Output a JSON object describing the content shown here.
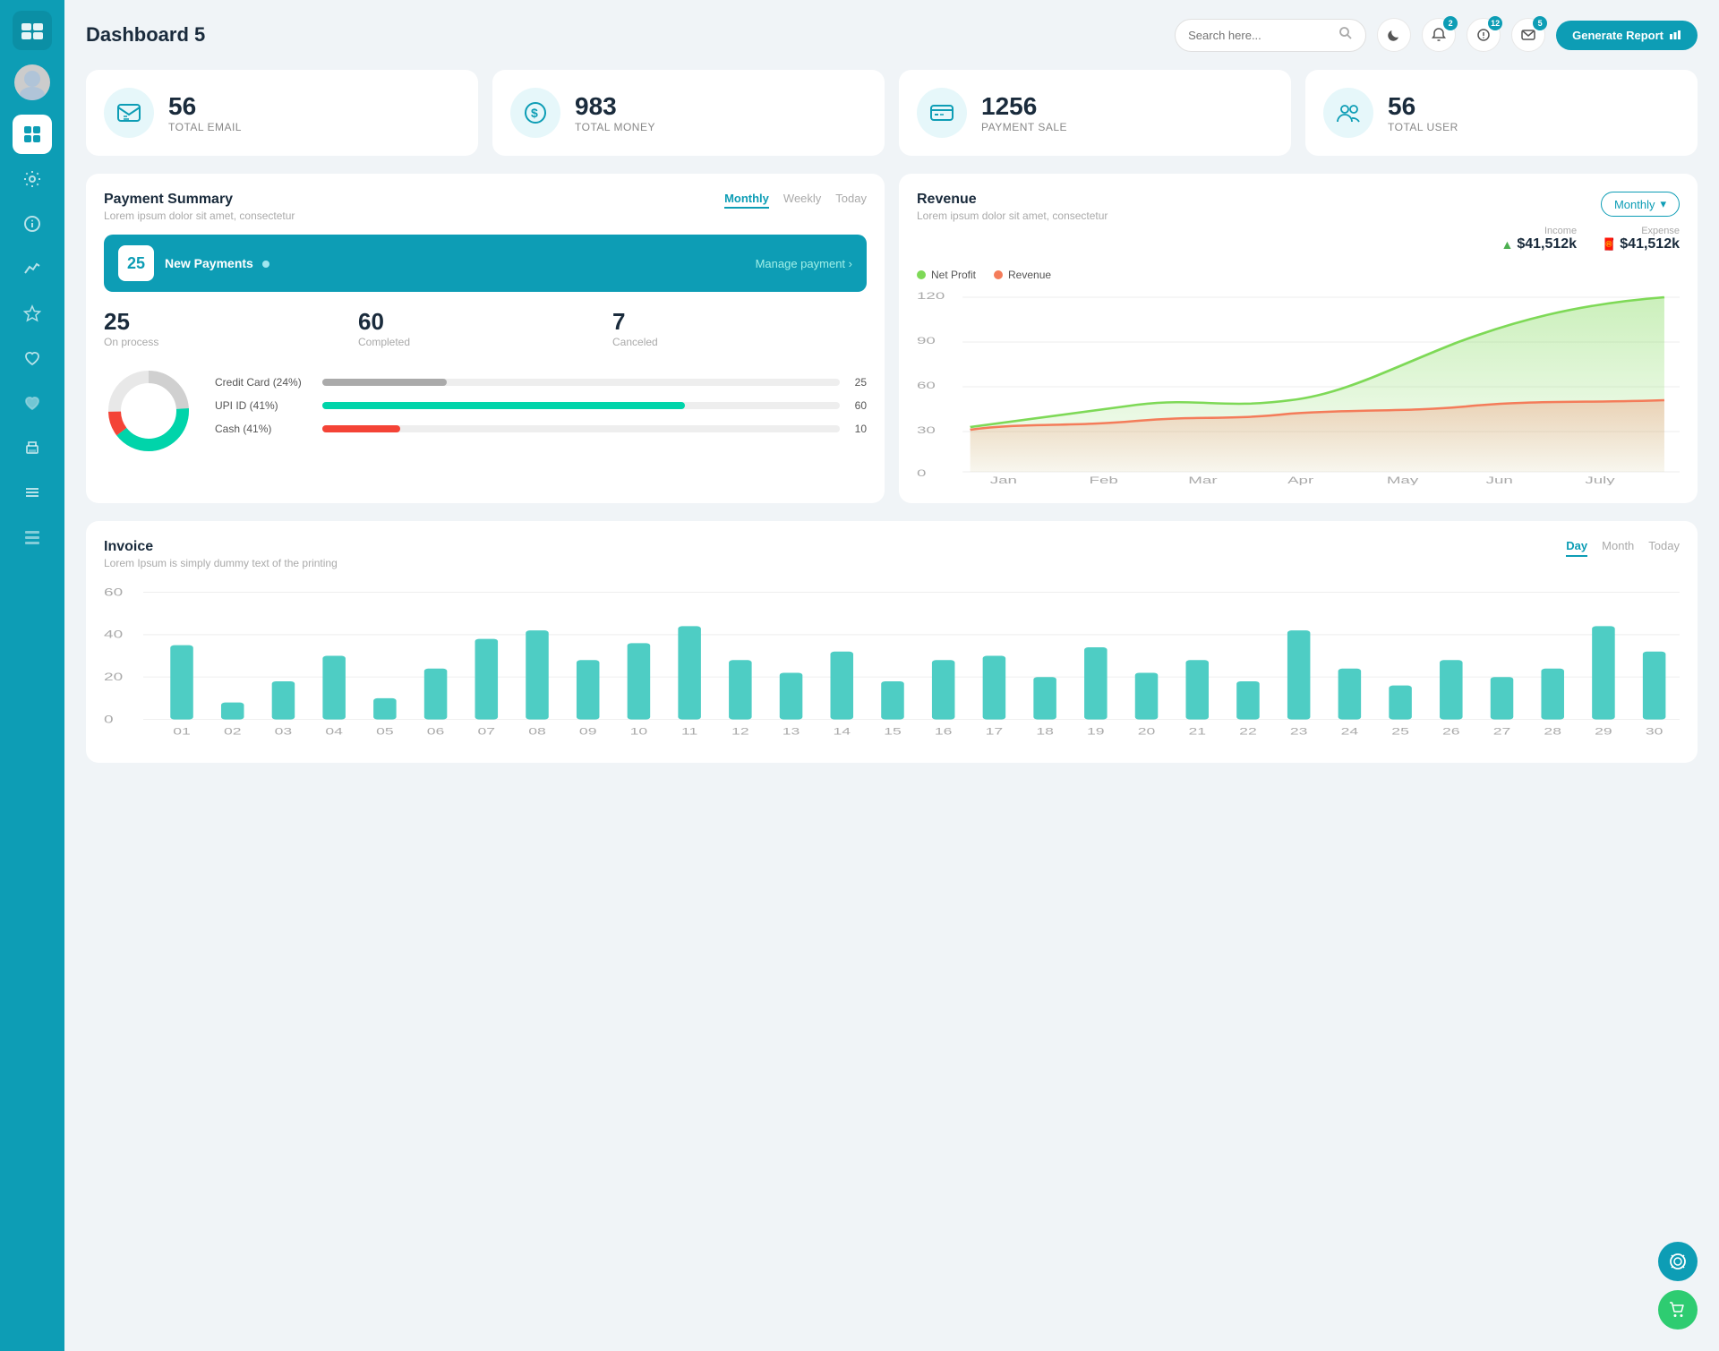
{
  "app": {
    "title": "Dashboard 5"
  },
  "header": {
    "search_placeholder": "Search here...",
    "generate_btn": "Generate Report",
    "badge_notifications": "2",
    "badge_alerts": "12",
    "badge_messages": "5"
  },
  "stats": [
    {
      "id": "total-email",
      "number": "56",
      "label": "TOTAL EMAIL",
      "icon": "📋"
    },
    {
      "id": "total-money",
      "number": "983",
      "label": "TOTAL MONEY",
      "icon": "💲"
    },
    {
      "id": "payment-sale",
      "number": "1256",
      "label": "PAYMENT SALE",
      "icon": "💳"
    },
    {
      "id": "total-user",
      "number": "56",
      "label": "TOTAL USER",
      "icon": "👥"
    }
  ],
  "payment_summary": {
    "title": "Payment Summary",
    "subtitle": "Lorem ipsum dolor sit amet, consectetur",
    "tabs": [
      "Monthly",
      "Weekly",
      "Today"
    ],
    "active_tab": "Monthly",
    "new_payments_count": "25",
    "new_payments_label": "New Payments",
    "manage_link": "Manage payment",
    "stats": [
      {
        "number": "25",
        "label": "On process"
      },
      {
        "number": "60",
        "label": "Completed"
      },
      {
        "number": "7",
        "label": "Canceled"
      }
    ],
    "payment_methods": [
      {
        "label": "Credit Card (24%)",
        "percent": 24,
        "color": "#aaa",
        "value": "25"
      },
      {
        "label": "UPI ID (41%)",
        "percent": 41,
        "color": "#00d4aa",
        "value": "60"
      },
      {
        "label": "Cash (41%)",
        "percent": 10,
        "color": "#f44336",
        "value": "10"
      }
    ],
    "donut": {
      "segments": [
        {
          "percent": 24,
          "color": "#d0d0d0"
        },
        {
          "percent": 41,
          "color": "#00d4aa"
        },
        {
          "percent": 10,
          "color": "#f44336"
        },
        {
          "percent": 25,
          "color": "#e0e0e0"
        }
      ]
    }
  },
  "revenue": {
    "title": "Revenue",
    "subtitle": "Lorem ipsum dolor sit amet, consectetur",
    "dropdown_label": "Monthly",
    "income": {
      "label": "Income",
      "amount": "$41,512k"
    },
    "expense": {
      "label": "Expense",
      "amount": "$41,512k"
    },
    "legend": [
      {
        "label": "Net Profit",
        "color": "#7ed957"
      },
      {
        "label": "Revenue",
        "color": "#f47c5a"
      }
    ],
    "chart_labels": [
      "Jan",
      "Feb",
      "Mar",
      "Apr",
      "May",
      "Jun",
      "July"
    ],
    "y_axis": [
      "120",
      "90",
      "60",
      "30",
      "0"
    ]
  },
  "invoice": {
    "title": "Invoice",
    "subtitle": "Lorem Ipsum is simply dummy text of the printing",
    "tabs": [
      "Day",
      "Month",
      "Today"
    ],
    "active_tab": "Day",
    "y_axis": [
      "60",
      "40",
      "20",
      "0"
    ],
    "x_axis": [
      "01",
      "02",
      "03",
      "04",
      "05",
      "06",
      "07",
      "08",
      "09",
      "10",
      "11",
      "12",
      "13",
      "14",
      "15",
      "16",
      "17",
      "18",
      "19",
      "20",
      "21",
      "22",
      "23",
      "24",
      "25",
      "26",
      "27",
      "28",
      "29",
      "30"
    ],
    "bar_color": "#4ecdc4",
    "bars": [
      35,
      8,
      18,
      30,
      10,
      24,
      38,
      42,
      28,
      36,
      44,
      28,
      22,
      32,
      18,
      28,
      30,
      20,
      34,
      22,
      28,
      18,
      42,
      24,
      16,
      28,
      20,
      24,
      44,
      32
    ]
  },
  "fab": {
    "support_icon": "💬",
    "cart_icon": "🛒"
  }
}
